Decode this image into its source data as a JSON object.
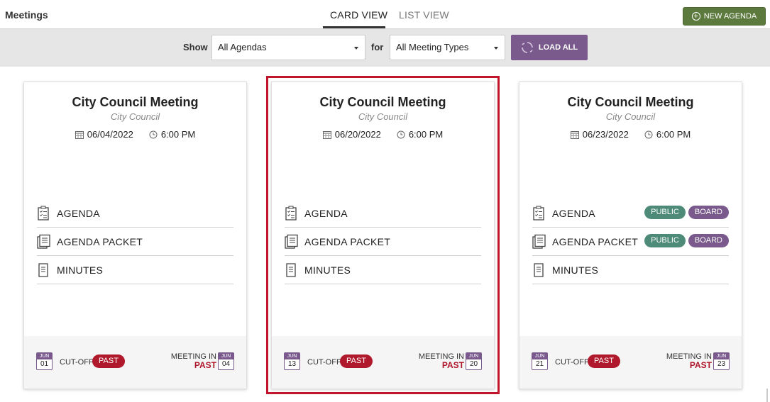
{
  "header": {
    "title": "Meetings",
    "tabs": [
      {
        "label": "CARD VIEW",
        "active": true
      },
      {
        "label": "LIST VIEW",
        "active": false
      }
    ],
    "new_agenda_label": "NEW AGENDA",
    "new_agenda_icon": "plus-circle-icon"
  },
  "filters": {
    "show_label": "Show",
    "agenda_select": "All Agendas",
    "for_label": "for",
    "type_select": "All Meeting Types",
    "load_all_label": "LOAD ALL",
    "load_all_icon": "refresh-icon"
  },
  "colors": {
    "accent_purple": "#7a5a8c",
    "new_agenda_green": "#5d7a3e",
    "past_red": "#b0182c",
    "public_teal": "#4d8a77",
    "selection_red": "#c0152b"
  },
  "cards": [
    {
      "title": "City Council Meeting",
      "subtitle": "City Council",
      "date": "06/04/2022",
      "time": "6:00 PM",
      "docs": [
        {
          "label": "AGENDA",
          "icon": "checklist-icon",
          "badges": []
        },
        {
          "label": "AGENDA PACKET",
          "icon": "packet-icon",
          "badges": []
        },
        {
          "label": "MINUTES",
          "icon": "document-icon",
          "badges": []
        }
      ],
      "cutoff": {
        "month": "JUN",
        "day": "01",
        "label": "CUT-OFF",
        "status": "PAST"
      },
      "meeting": {
        "label": "MEETING IN",
        "status": "PAST",
        "month": "JUN",
        "day": "04"
      },
      "selected": false
    },
    {
      "title": "City Council Meeting",
      "subtitle": "City Council",
      "date": "06/20/2022",
      "time": "6:00 PM",
      "docs": [
        {
          "label": "AGENDA",
          "icon": "checklist-icon",
          "badges": []
        },
        {
          "label": "AGENDA PACKET",
          "icon": "packet-icon",
          "badges": []
        },
        {
          "label": "MINUTES",
          "icon": "document-icon",
          "badges": []
        }
      ],
      "cutoff": {
        "month": "JUN",
        "day": "13",
        "label": "CUT-OFF",
        "status": "PAST"
      },
      "meeting": {
        "label": "MEETING IN",
        "status": "PAST",
        "month": "JUN",
        "day": "20"
      },
      "selected": true
    },
    {
      "title": "City Council Meeting",
      "subtitle": "City Council",
      "date": "06/23/2022",
      "time": "6:00 PM",
      "docs": [
        {
          "label": "AGENDA",
          "icon": "checklist-icon",
          "badges": [
            "PUBLIC",
            "BOARD"
          ]
        },
        {
          "label": "AGENDA PACKET",
          "icon": "packet-icon",
          "badges": [
            "PUBLIC",
            "BOARD"
          ]
        },
        {
          "label": "MINUTES",
          "icon": "document-icon",
          "badges": []
        }
      ],
      "cutoff": {
        "month": "JUN",
        "day": "21",
        "label": "CUT-OFF",
        "status": "PAST"
      },
      "meeting": {
        "label": "MEETING IN",
        "status": "PAST",
        "month": "JUN",
        "day": "23"
      },
      "selected": false
    }
  ]
}
